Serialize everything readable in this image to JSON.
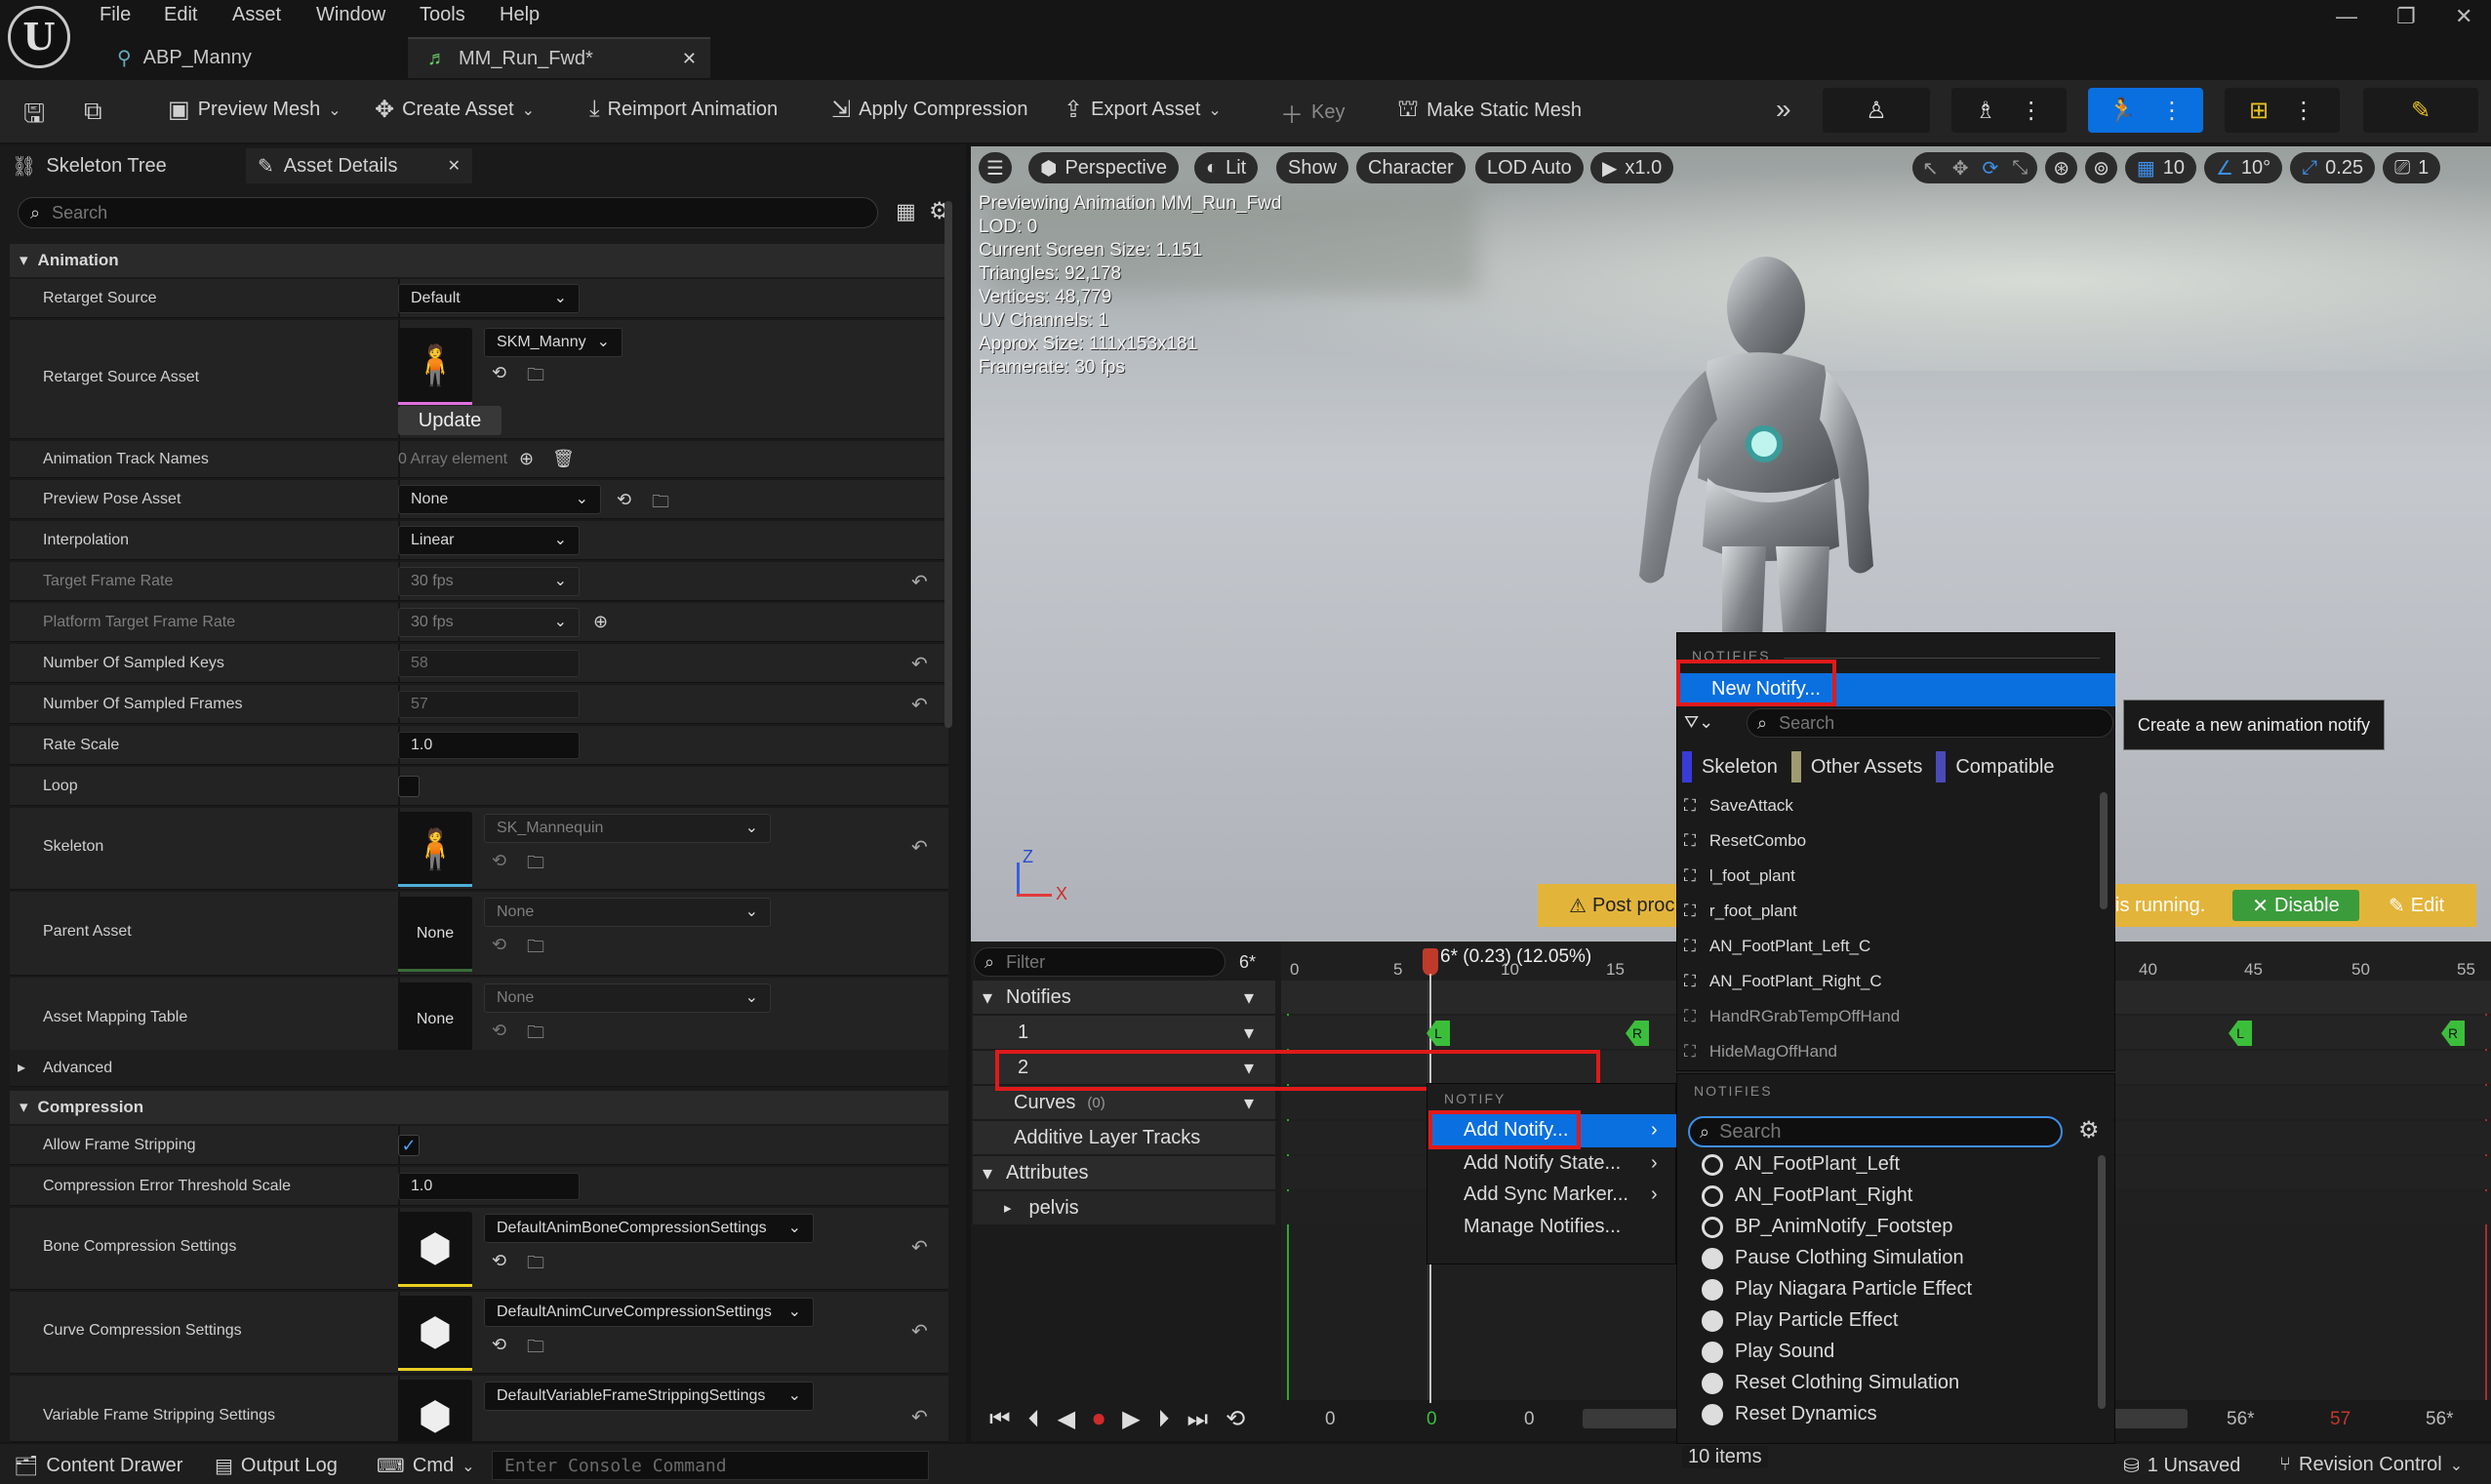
{
  "menu": [
    "File",
    "Edit",
    "Asset",
    "Window",
    "Tools",
    "Help"
  ],
  "tabs": [
    {
      "label": "ABP_Manny"
    },
    {
      "label": "MM_Run_Fwd*"
    }
  ],
  "toolbar": {
    "preview_mesh": "Preview Mesh",
    "create_asset": "Create Asset",
    "reimport": "Reimport Animation",
    "apply_compression": "Apply Compression",
    "export_asset": "Export Asset",
    "key": "Key",
    "make_static_mesh": "Make Static Mesh"
  },
  "panel_tabs": {
    "skeleton_tree": "Skeleton Tree",
    "asset_details": "Asset Details"
  },
  "details": {
    "search_placeholder": "Search",
    "animation_category": "Animation",
    "retarget_source": {
      "label": "Retarget Source",
      "value": "Default"
    },
    "retarget_source_asset": {
      "label": "Retarget Source Asset",
      "value": "SKM_Manny",
      "button": "Update"
    },
    "animation_track_names": {
      "label": "Animation Track Names",
      "value": "0 Array element"
    },
    "preview_pose_asset": {
      "label": "Preview Pose Asset",
      "value": "None"
    },
    "interpolation": {
      "label": "Interpolation",
      "value": "Linear"
    },
    "target_frame_rate": {
      "label": "Target Frame Rate",
      "value": "30 fps"
    },
    "platform_target_frame_rate": {
      "label": "Platform Target Frame Rate",
      "value": "30 fps"
    },
    "number_of_sampled_keys": {
      "label": "Number Of Sampled Keys",
      "value": "58"
    },
    "number_of_sampled_frames": {
      "label": "Number Of Sampled Frames",
      "value": "57"
    },
    "rate_scale": {
      "label": "Rate Scale",
      "value": "1.0"
    },
    "loop": {
      "label": "Loop"
    },
    "skeleton": {
      "label": "Skeleton",
      "value": "SK_Mannequin"
    },
    "parent_asset": {
      "label": "Parent Asset",
      "value": "None",
      "thumb": "None"
    },
    "asset_mapping_table": {
      "label": "Asset Mapping Table",
      "value": "None",
      "thumb": "None"
    },
    "advanced_category": "Advanced",
    "compression_category": "Compression",
    "allow_frame_stripping": {
      "label": "Allow Frame Stripping",
      "check": "✓"
    },
    "compression_error_threshold": {
      "label": "Compression Error Threshold Scale",
      "value": "1.0"
    },
    "bone_compression": {
      "label": "Bone Compression Settings",
      "value": "DefaultAnimBoneCompressionSettings"
    },
    "curve_compression": {
      "label": "Curve Compression Settings",
      "value": "DefaultAnimCurveCompressionSettings"
    },
    "variable_frame_stripping": {
      "label": "Variable Frame Stripping Settings",
      "value": "DefaultVariableFrameStrippingSettings"
    }
  },
  "viewport": {
    "perspective": "Perspective",
    "lit": "Lit",
    "show": "Show",
    "character": "Character",
    "lod": "LOD Auto",
    "speed": "x1.0",
    "grid_value": "10",
    "angle_value": "10°",
    "scale_value": "0.25",
    "camera_value": "1",
    "stats": [
      "Previewing Animation MM_Run_Fwd",
      "LOD: 0",
      "Current Screen Size: 1.151",
      "Triangles: 92,178",
      "Vertices: 48,779",
      "UV Channels: 1",
      "Approx Size: 111x153x181",
      "Framerate: 30 fps"
    ],
    "warning_left": "Post proc",
    "warning_right": "is running.",
    "disable": "Disable",
    "edit": "Edit",
    "axis_z": "Z",
    "axis_x": "X"
  },
  "sequencer": {
    "filter_placeholder": "Filter",
    "frame_badge": "6*",
    "notifies": "Notifies",
    "track1": "1",
    "track2": "2",
    "curves": "Curves",
    "curves_count": "(0)",
    "additive": "Additive Layer Tracks",
    "attributes": "Attributes",
    "pelvis": "pelvis",
    "playhead_label": "6* (0.23) (12.05%)",
    "ticks": [
      "0",
      "5",
      "10",
      "15",
      "40",
      "45",
      "50",
      "55"
    ],
    "marker_L": "L",
    "marker_R": "R",
    "bottom_values": [
      "0",
      "0",
      "0",
      "56*",
      "57",
      "56*"
    ]
  },
  "notify_menu": {
    "section": "NOTIFY",
    "add_notify": "Add Notify...",
    "add_notify_state": "Add Notify State...",
    "add_sync_marker": "Add Sync Marker...",
    "manage_notifies": "Manage Notifies..."
  },
  "notifies_popup": {
    "section": "NOTIFIES",
    "new_notify": "New Notify...",
    "search_placeholder": "Search",
    "filters": [
      "Skeleton",
      "Other Assets",
      "Compatible"
    ],
    "items": [
      "SaveAttack",
      "ResetCombo",
      "l_foot_plant",
      "r_foot_plant",
      "AN_FootPlant_Left_C",
      "AN_FootPlant_Right_C",
      "HandRGrabTempOffHand",
      "HideMagOffHand"
    ]
  },
  "class_picker": {
    "section": "NOTIFIES",
    "search_placeholder": "Search",
    "items": [
      "AN_FootPlant_Left",
      "AN_FootPlant_Right",
      "BP_AnimNotify_Footstep",
      "Pause Clothing Simulation",
      "Play Niagara Particle Effect",
      "Play Particle Effect",
      "Play Sound",
      "Reset Clothing Simulation",
      "Reset Dynamics"
    ],
    "count": "10 items"
  },
  "tooltip": "Create a new animation notify",
  "statusbar": {
    "content_drawer": "Content Drawer",
    "output_log": "Output Log",
    "cmd": "Cmd",
    "console_placeholder": "Enter Console Command",
    "unsaved": "1 Unsaved",
    "revision_control": "Revision Control"
  },
  "colors": {
    "accent": "#0a6fdf",
    "highlight_red": "#e01a1a",
    "notify_green": "#3bbf3b",
    "warning": "#e3b43a"
  }
}
